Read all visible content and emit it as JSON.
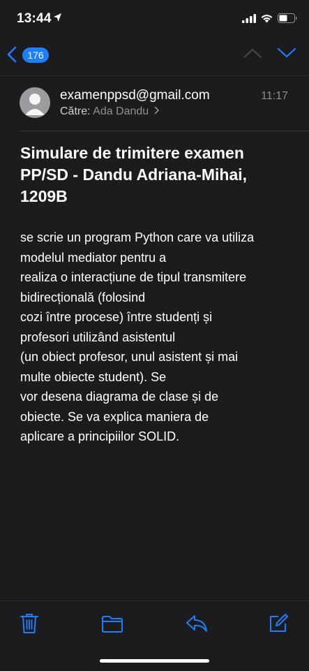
{
  "status": {
    "time": "13:44"
  },
  "nav": {
    "unread_count": "176"
  },
  "message": {
    "from": "examenppsd@gmail.com",
    "to_label": "Către:",
    "to_name": "Ada Dandu",
    "time": "11:17",
    "subject": "Simulare de trimitere examen PP/SD - Dandu Adriana-Mihai, 1209B",
    "body_lines": [
      "se scrie un program Python care va utiliza",
      "modelul mediator pentru a",
      "realiza o interacțiune de tipul transmitere",
      "bidirecțională (folosind",
      "cozi între procese) între studenți și",
      "profesori utilizând asistentul",
      "(un obiect profesor, unul asistent și mai",
      "multe obiecte student). Se",
      "vor desena diagrama de clase și de",
      "obiecte. Se va explica maniera de",
      "aplicare a principiilor SOLID."
    ]
  },
  "colors": {
    "accent": "#1e7ffc",
    "background": "#1c1c1e",
    "secondary_text": "#8e8e93"
  },
  "icons": {
    "location": "location-arrow-icon",
    "signal": "cellular-signal-icon",
    "wifi": "wifi-icon",
    "battery": "battery-icon",
    "back": "chevron-left-icon",
    "up": "chevron-up-icon",
    "down": "chevron-down-icon",
    "trash": "trash-icon",
    "folder": "folder-icon",
    "reply": "reply-icon",
    "compose": "compose-icon"
  }
}
